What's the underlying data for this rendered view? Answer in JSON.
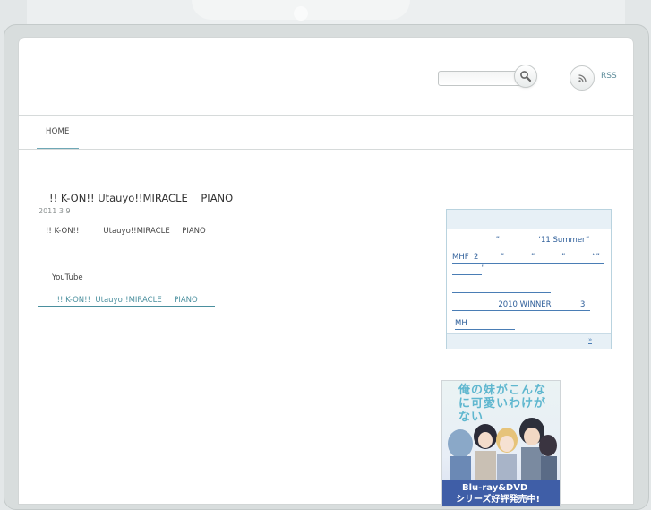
{
  "header": {
    "search_placeholder": "",
    "rss_label": "RSS"
  },
  "nav": {
    "home": "HOME"
  },
  "post": {
    "title": "!! K-ON!! Utauyo!!MIRACLE    PIANO",
    "date": "2011  3 9",
    "body_line": "!! K-ON!!          Utauyo!!MIRACLE     PIANO",
    "youtube_label": "YouTube",
    "link_text": "        !! K-ON!!  Utauyo!!MIRACLE     PIANO       "
  },
  "sidebar": {
    "items": [
      "                  ”                ‘11 Summer”                ",
      "MHF  2         ”           ”           ”           “”  ",
      "            ”       ",
      "                                                     ",
      "                   2010 WINNER            3         ",
      "MH                        "
    ],
    "more_link": "    »"
  },
  "banner": {
    "logo_text": "俺の妹がこんなに可愛いわけがない",
    "line1": "Blu-ray&DVD",
    "line2": "シリーズ好評発売中!"
  }
}
